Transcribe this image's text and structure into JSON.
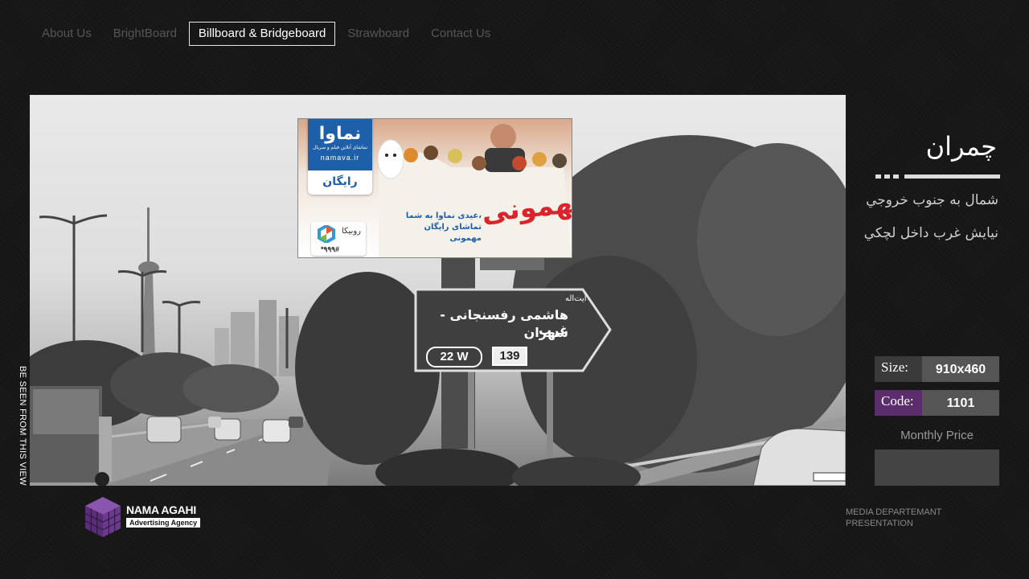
{
  "nav": {
    "items": [
      {
        "label": "About Us",
        "active": false
      },
      {
        "label": "BrightBoard",
        "active": false
      },
      {
        "label": "Billboard & Bridgeboard",
        "active": true
      },
      {
        "label": "Strawboard",
        "active": false
      },
      {
        "label": "Contact Us",
        "active": false
      }
    ]
  },
  "photo": {
    "caption": "BE SEEN FROM THIS VIEW",
    "ad": {
      "brand_logo": "نماوا",
      "brand_tagline": "تماشای آنلاین فیلم و سریال",
      "brand_url": "namava.ir",
      "brand_free": "رایگان",
      "title": "مهمونی",
      "text_line1": "عیدی نماوا به شما،",
      "text_line2": "تماشای رایگان مهمونی",
      "partner": "روبیکا",
      "partner_code": "*۹۹۹#"
    },
    "road_sign": {
      "street": "آیت‌اله",
      "line1": "هاشمی رفسنجانی - غرب",
      "line2": "شهران",
      "route": "22 W",
      "number": "139"
    }
  },
  "panel": {
    "title": "چمران",
    "description_line1": "شمال به جنوب خروجي",
    "description_line2": "نيايش غرب داخل لچكي",
    "size_label": "Size:",
    "size_value": "910x460",
    "code_label": "Code:",
    "code_value": "1101",
    "price_label": "Monthly Price",
    "price_value": ""
  },
  "footer": {
    "logo_name": "NAMA AGAHI",
    "logo_tagline": "Advertising Agency",
    "right_line1": "MEDIA DEPARTEMANT",
    "right_line2": "PRESENTATION"
  },
  "colors": {
    "background": "#141414",
    "code_accent": "#5b2d6d",
    "logo_purple": "#6b3a8c",
    "ad_blue": "#1d5fa8",
    "ad_red": "#d9242b"
  }
}
